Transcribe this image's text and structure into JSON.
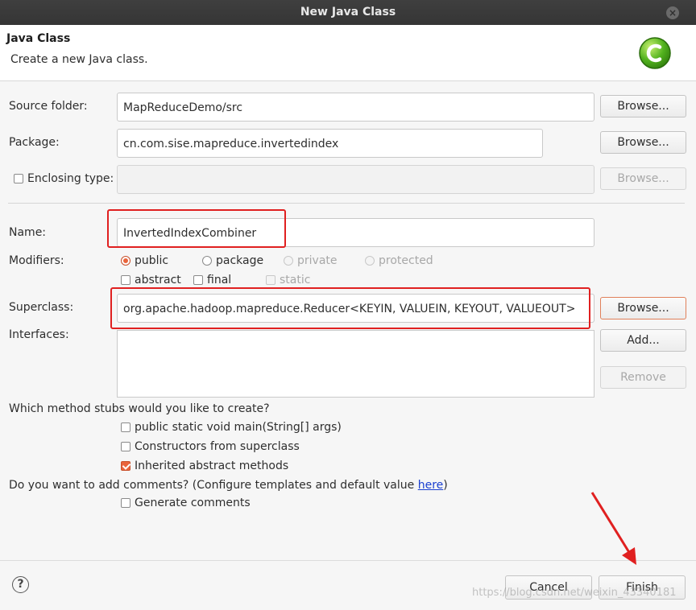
{
  "window": {
    "title": "New Java Class"
  },
  "banner": {
    "title": "Java Class",
    "description": "Create a new Java class."
  },
  "source_folder": {
    "label": "Source folder:",
    "value": "MapReduceDemo/src",
    "button": "Browse..."
  },
  "package": {
    "label": "Package:",
    "value": "cn.com.sise.mapreduce.invertedindex",
    "button": "Browse..."
  },
  "enclosing_type": {
    "label": "Enclosing type:",
    "value": "",
    "button": "Browse...",
    "checked": false
  },
  "name": {
    "label": "Name:",
    "value": "InvertedIndexCombiner"
  },
  "modifiers": {
    "label": "Modifiers:",
    "access": [
      {
        "label": "public",
        "selected": true,
        "enabled": true
      },
      {
        "label": "package",
        "selected": false,
        "enabled": true
      },
      {
        "label": "private",
        "selected": false,
        "enabled": false
      },
      {
        "label": "protected",
        "selected": false,
        "enabled": false
      }
    ],
    "flags": [
      {
        "label": "abstract",
        "checked": false,
        "enabled": true
      },
      {
        "label": "final",
        "checked": false,
        "enabled": true
      },
      {
        "label": "static",
        "checked": false,
        "enabled": false
      }
    ]
  },
  "superclass": {
    "label": "Superclass:",
    "value": "org.apache.hadoop.mapreduce.Reducer<KEYIN, VALUEIN, KEYOUT, VALUEOUT>",
    "button": "Browse..."
  },
  "interfaces": {
    "label": "Interfaces:",
    "add_button": "Add...",
    "remove_button": "Remove"
  },
  "method_stubs": {
    "question": "Which method stubs would you like to create?",
    "options": [
      {
        "label": "public static void main(String[] args)",
        "checked": false
      },
      {
        "label": "Constructors from superclass",
        "checked": false
      },
      {
        "label": "Inherited abstract methods",
        "checked": true
      }
    ]
  },
  "comments": {
    "question_prefix": "Do you want to add comments? (Configure templates and default value ",
    "link": "here",
    "question_suffix": ")",
    "option": "Generate comments",
    "checked": false
  },
  "footer": {
    "cancel": "Cancel",
    "finish": "Finish"
  },
  "watermark": "https://blog.csdn.net/weixin_43340181",
  "colors": {
    "accent": "#e9643b",
    "highlight": "#e02020",
    "link": "#1a3fd0"
  }
}
